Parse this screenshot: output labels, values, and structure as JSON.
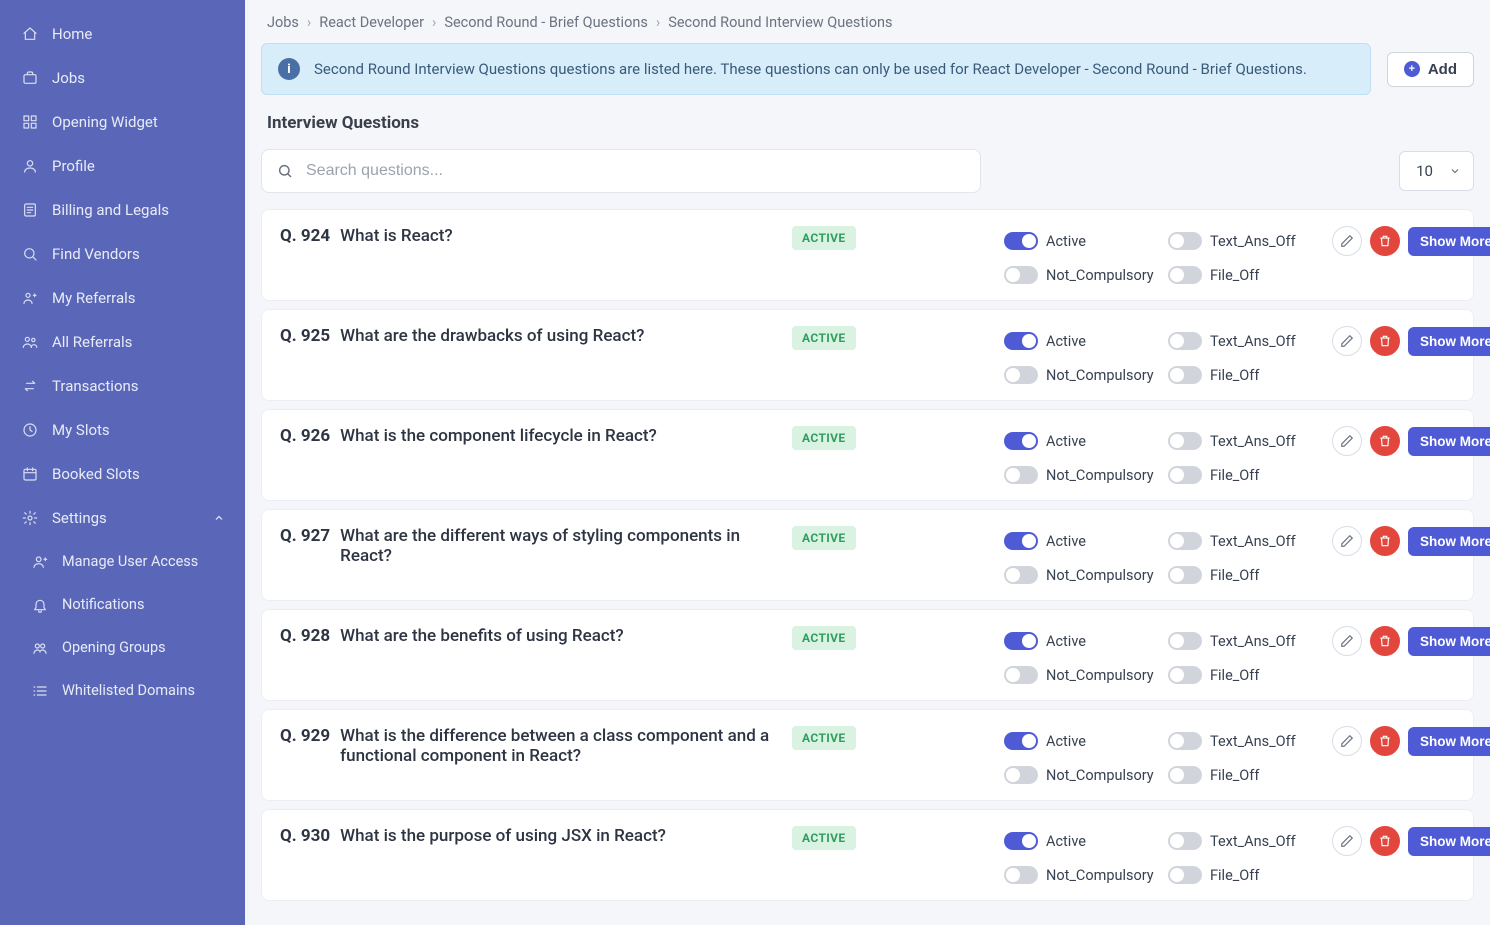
{
  "sidebar": {
    "items": [
      {
        "label": "Home",
        "icon": "home"
      },
      {
        "label": "Jobs",
        "icon": "briefcase"
      },
      {
        "label": "Opening Widget",
        "icon": "widget"
      },
      {
        "label": "Profile",
        "icon": "profile"
      },
      {
        "label": "Billing and Legals",
        "icon": "billing"
      },
      {
        "label": "Find Vendors",
        "icon": "search"
      },
      {
        "label": "My Referrals",
        "icon": "referral"
      },
      {
        "label": "All Referrals",
        "icon": "referrals"
      },
      {
        "label": "Transactions",
        "icon": "transactions"
      },
      {
        "label": "My Slots",
        "icon": "clock"
      },
      {
        "label": "Booked Slots",
        "icon": "calendar"
      },
      {
        "label": "Settings",
        "icon": "gear",
        "expandable": true
      }
    ],
    "sub_items": [
      {
        "label": "Manage User Access",
        "icon": "user-add"
      },
      {
        "label": "Notifications",
        "icon": "bell"
      },
      {
        "label": "Opening Groups",
        "icon": "groups"
      },
      {
        "label": "Whitelisted Domains",
        "icon": "list"
      }
    ]
  },
  "breadcrumb": [
    "Jobs",
    "React Developer",
    "Second Round - Brief Questions",
    "Second Round Interview Questions"
  ],
  "banner": {
    "text": "Second Round Interview Questions questions are listed here. These questions can only be used for React Developer - Second Round - Brief Questions."
  },
  "buttons": {
    "add": "Add",
    "show_more": "Show More"
  },
  "section_title": "Interview Questions",
  "search": {
    "placeholder": "Search questions..."
  },
  "page_size": "10",
  "status_labels": {
    "active_badge": "ACTIVE"
  },
  "toggle_labels": {
    "active": "Active",
    "not_compulsory": "Not_Compulsory",
    "text_ans_off": "Text_Ans_Off",
    "file_off": "File_Off"
  },
  "questions": [
    {
      "num": "Q. 924",
      "text": "What is React?",
      "status": "ACTIVE"
    },
    {
      "num": "Q. 925",
      "text": "What are the drawbacks of using React?",
      "status": "ACTIVE"
    },
    {
      "num": "Q. 926",
      "text": "What is the component lifecycle in React?",
      "status": "ACTIVE"
    },
    {
      "num": "Q. 927",
      "text": "What are the different ways of styling components in React?",
      "status": "ACTIVE"
    },
    {
      "num": "Q. 928",
      "text": "What are the benefits of using React?",
      "status": "ACTIVE"
    },
    {
      "num": "Q. 929",
      "text": "What is the difference between a class component and a functional component in React?",
      "status": "ACTIVE"
    },
    {
      "num": "Q. 930",
      "text": "What is the purpose of using JSX in React?",
      "status": "ACTIVE"
    }
  ]
}
